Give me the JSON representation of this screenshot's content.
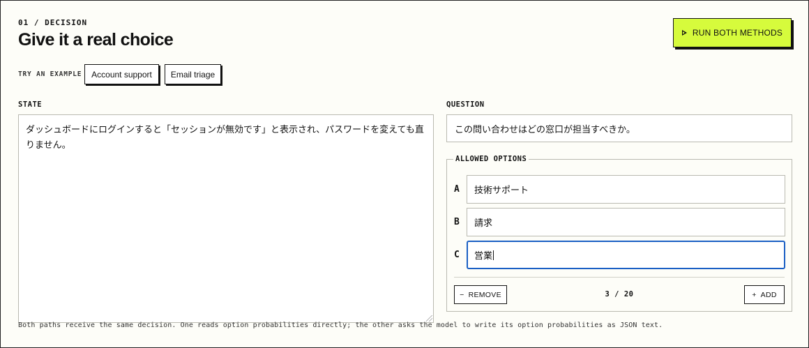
{
  "header": {
    "kicker": "01 / DECISION",
    "title": "Give it a real choice",
    "run_button": "RUN BOTH METHODS"
  },
  "examples": {
    "label": "TRY AN EXAMPLE",
    "items": [
      "Account support",
      "Email triage"
    ]
  },
  "state": {
    "label": "STATE",
    "text": "ダッシュボードにログインすると「セッションが無効です」と表示され、パスワードを変えても直りません。"
  },
  "question": {
    "label": "QUESTION",
    "text": "この問い合わせはどの窓口が担当すべきか。"
  },
  "options": {
    "legend": "ALLOWED OPTIONS",
    "items": [
      {
        "letter": "A",
        "value": "技術サポート"
      },
      {
        "letter": "B",
        "value": "請求"
      },
      {
        "letter": "C",
        "value": "営業"
      }
    ],
    "remove_label": "REMOVE",
    "add_label": "ADD",
    "counter": "3 / 20"
  },
  "footnote": "Both paths receive the same decision. One reads option probabilities directly; the other asks the model to write its option probabilities as JSON text.",
  "colors": {
    "accent": "#d6fb3c",
    "focus": "#1a5fc4",
    "background": "#fdfdf8"
  }
}
